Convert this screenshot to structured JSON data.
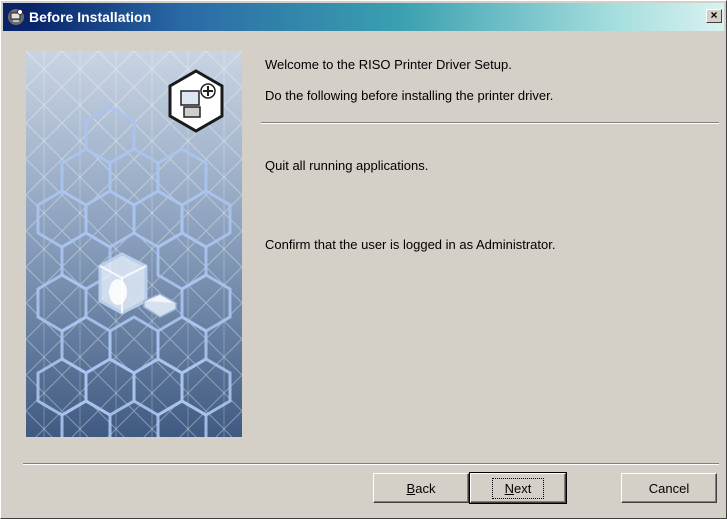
{
  "window": {
    "title": "Before Installation",
    "close_glyph": "×"
  },
  "content": {
    "welcome": "Welcome to the RISO Printer Driver Setup.",
    "instruction": "Do the following before installing the printer driver.",
    "step1": "Quit all running applications.",
    "step2": "Confirm that the user is logged in as Administrator."
  },
  "buttons": {
    "back": {
      "first": "B",
      "rest": "ack"
    },
    "next": {
      "first": "N",
      "rest": "ext"
    },
    "cancel": "Cancel"
  },
  "icons": {
    "title": "installer-computer-icon",
    "overlay": "computer-add-icon",
    "center": "printer-cube-icon"
  }
}
